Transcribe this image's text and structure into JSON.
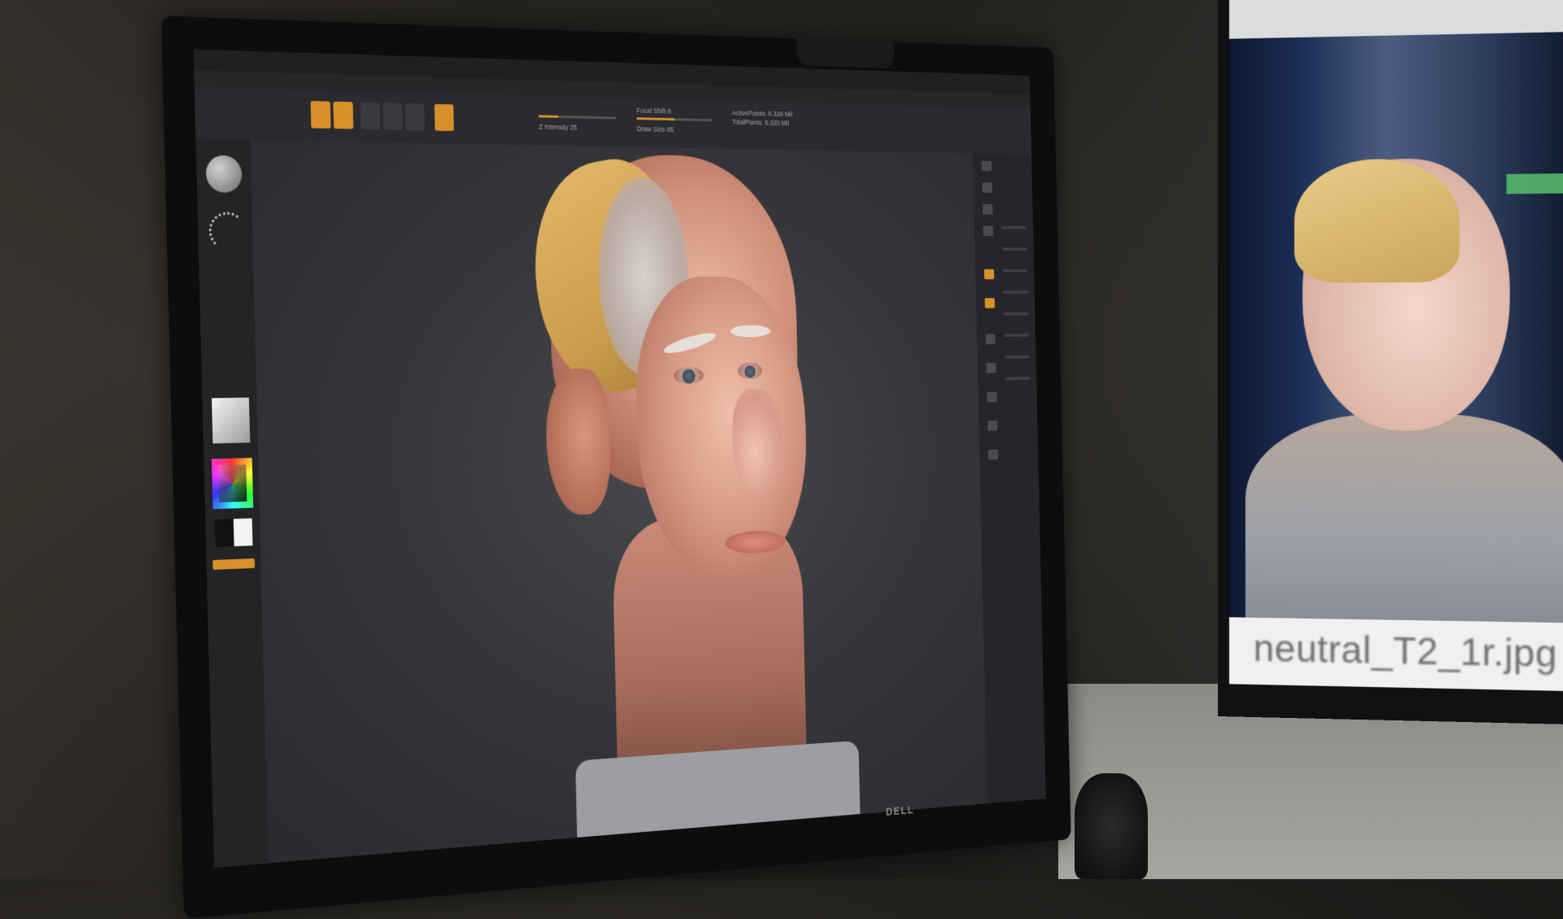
{
  "app": {
    "title": "",
    "menu": []
  },
  "toolbar": {
    "focal_shift": "Focal Shift 0",
    "draw_size": "Draw Size 85",
    "z_intensity": "Z Intensity 25",
    "active_points": "ActivePoints: 6.320 Mil",
    "total_points": "TotalPoints: 6.320 Mil"
  },
  "reference": {
    "caption": "neutral_T2_1r.jpg"
  },
  "monitor": {
    "brand": "DELL"
  },
  "colors": {
    "accent": "#d7902a",
    "viewport": "#35363a",
    "ui_dark": "#232426"
  },
  "icons": {
    "brush": "sphere-brush-icon",
    "stroke": "dots-stroke-icon",
    "material": "material-icon",
    "color": "color-picker-icon"
  }
}
